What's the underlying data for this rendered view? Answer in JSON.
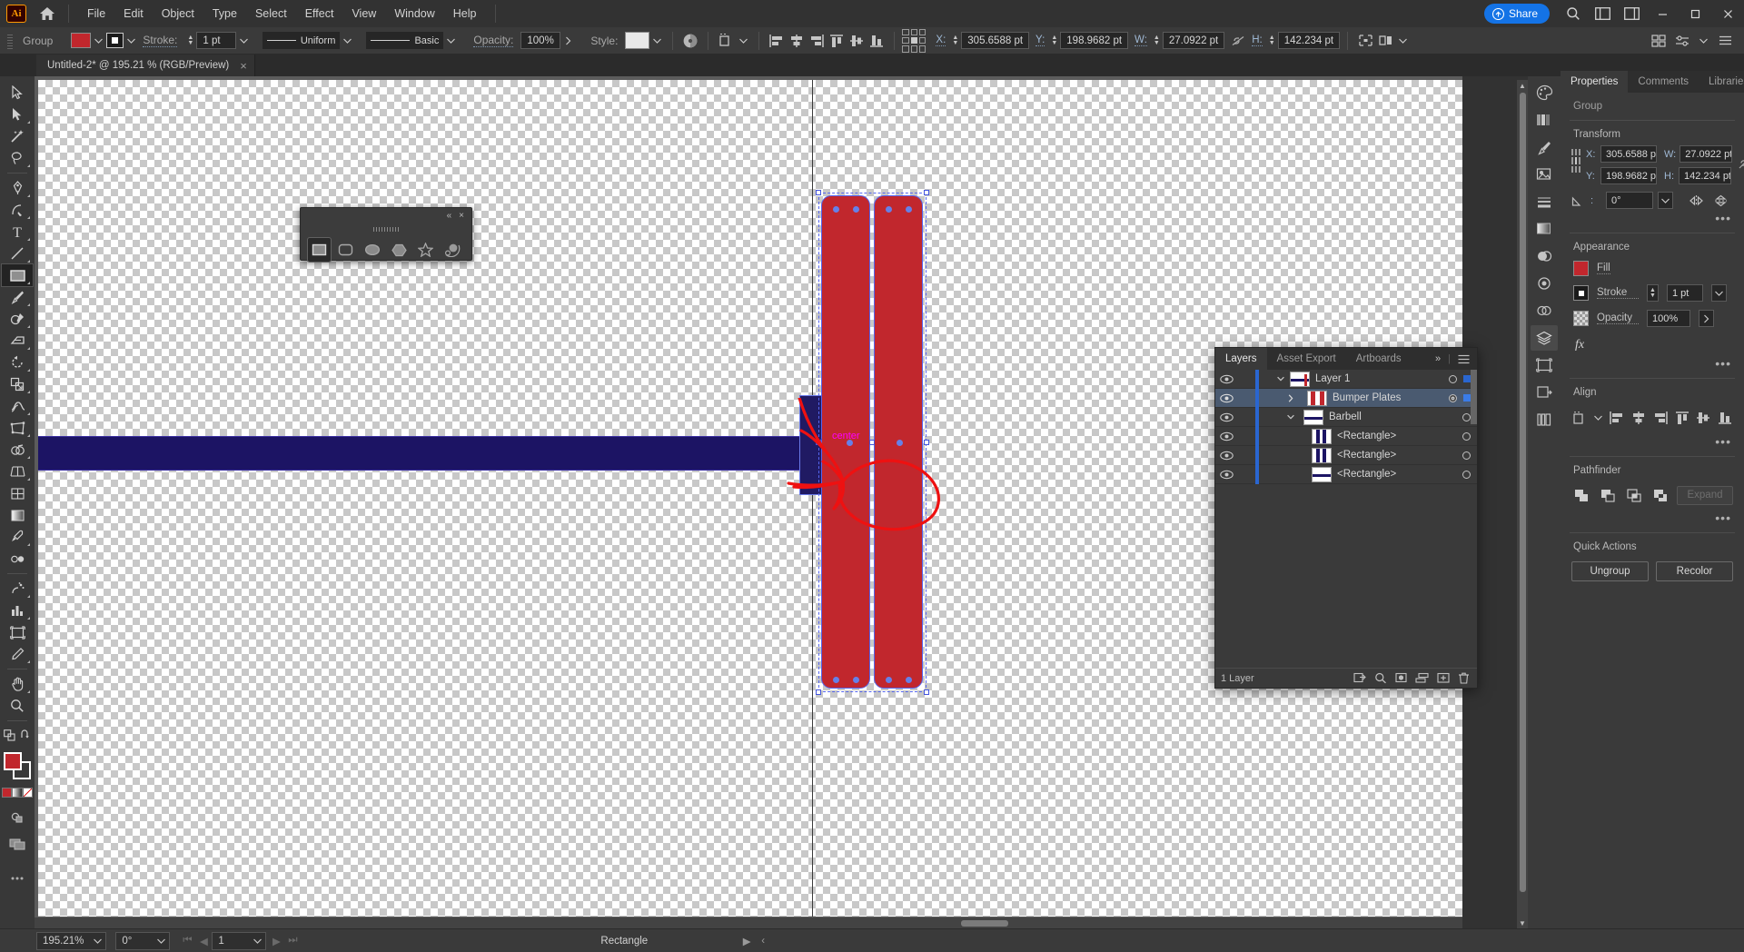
{
  "app": {
    "name": "Adobe Illustrator",
    "logo_text": "Ai"
  },
  "menubar": {
    "items": [
      "File",
      "Edit",
      "Object",
      "Type",
      "Select",
      "Effect",
      "View",
      "Window",
      "Help"
    ],
    "share_label": "Share",
    "icons": [
      "home-icon",
      "search-icon",
      "arrange-documents-icon",
      "workspace-switcher-icon"
    ],
    "window_controls": [
      "minimize",
      "maximize",
      "close"
    ]
  },
  "controlbar": {
    "selection_label": "Group",
    "fill_color": "#c1272d",
    "stroke_color": "#ffffff",
    "stroke_label": "Stroke:",
    "stroke_weight": "1 pt",
    "stroke_profile": "Uniform",
    "brush_definition": "Basic",
    "opacity_label": "Opacity:",
    "opacity_value": "100%",
    "style_label": "Style:",
    "transform": {
      "x_label": "X:",
      "x_value": "305.6588 pt",
      "y_label": "Y:",
      "y_value": "198.9682 pt",
      "w_label": "W:",
      "w_value": "27.0922 pt",
      "h_label": "H:",
      "h_value": "142.234 pt"
    }
  },
  "tabbar": {
    "documents": [
      {
        "title": "Untitled-2* @ 195.21 % (RGB/Preview)",
        "close": "×",
        "active": true
      }
    ]
  },
  "toolbar": {
    "tools": [
      "selection-tool",
      "direct-selection-tool",
      "magic-wand-tool",
      "lasso-tool",
      "pen-tool",
      "curvature-tool",
      "type-tool",
      "line-segment-tool",
      "rectangle-tool",
      "paintbrush-tool",
      "shaper-tool",
      "eraser-tool",
      "rotate-tool",
      "scale-tool",
      "width-tool",
      "free-transform-tool",
      "shape-builder-tool",
      "perspective-grid-tool",
      "mesh-tool",
      "gradient-tool",
      "eyedropper-tool",
      "blend-tool",
      "symbol-sprayer-tool",
      "column-graph-tool",
      "artboard-tool",
      "slice-tool",
      "hand-tool",
      "zoom-tool"
    ],
    "active_tool": "rectangle-tool",
    "fill_color": "#c1272d",
    "stroke_color": "#ffffff",
    "bottom_tools": [
      "swap-fill-stroke-icon",
      "default-fill-stroke-icon",
      "color-swatch-icon",
      "gradient-swatch-icon",
      "none-swatch-icon",
      "drawing-mode-icon",
      "screen-mode-icon",
      "edit-toolbar-icon"
    ]
  },
  "float_panel": {
    "name": "shape-tool-flyout",
    "collapse": "«",
    "close": "×",
    "shapes": [
      "rectangle-tool",
      "rounded-rectangle-tool",
      "ellipse-tool",
      "polygon-tool",
      "star-tool",
      "flare-tool"
    ],
    "selected": "rectangle-tool"
  },
  "canvas": {
    "artboard_label": "",
    "center_label": "center",
    "shape_fill": "#c1272d",
    "selection_color": "#5566ee",
    "bar_color": "#1c1464"
  },
  "properties": {
    "tabs": [
      "Properties",
      "Comments",
      "Libraries"
    ],
    "active_tab": "Properties",
    "object_type": "Group",
    "transform": {
      "title": "Transform",
      "x_label": "X:",
      "x_value": "305.6588 p",
      "y_label": "Y:",
      "y_value": "198.9682 p",
      "w_label": "W:",
      "w_value": "27.0922 pt",
      "h_label": "H:",
      "h_value": "142.234 pt",
      "angle_value": "0°",
      "link_icon": "constrain-proportions-unlinked-icon",
      "flip_icons": [
        "flip-horizontal-icon",
        "flip-vertical-icon"
      ]
    },
    "appearance": {
      "title": "Appearance",
      "fill_label": "Fill",
      "fill_color": "#c1272d",
      "stroke_label": "Stroke",
      "stroke_value": "1 pt",
      "opacity_label": "Opacity",
      "opacity_value": "100%",
      "fx_label": "fx"
    },
    "align": {
      "title": "Align",
      "buttons": [
        "align-to-selection-icon",
        "align-left-icon",
        "align-horizontal-center-icon",
        "align-right-icon",
        "align-top-icon",
        "align-vertical-center-icon",
        "align-bottom-icon"
      ]
    },
    "pathfinder": {
      "title": "Pathfinder",
      "buttons": [
        "unite-icon",
        "minus-front-icon",
        "intersect-icon",
        "exclude-icon"
      ],
      "expand_label": "Expand"
    },
    "quick_actions": {
      "title": "Quick Actions",
      "buttons": [
        "Ungroup",
        "Recolor"
      ]
    },
    "more_label": "•••"
  },
  "rail": {
    "icons": [
      "color-panel-icon",
      "color-guide-icon",
      "properties-panel-icon",
      "brushes-panel-icon",
      "symbols-panel-icon",
      "stroke-panel-icon",
      "gradient-panel-icon",
      "transparency-panel-icon",
      "appearance-panel-icon",
      "graphic-styles-icon",
      "layers-panel-icon",
      "artboards-panel-icon",
      "asset-export-icon",
      "libraries-panel-icon"
    ]
  },
  "layers_panel": {
    "tabs": [
      "Layers",
      "Asset Export",
      "Artboards"
    ],
    "active_tab": "Layers",
    "collapse_icon": "»",
    "menu_icon": "panel-menu-icon",
    "rows": [
      {
        "name": "Layer 1",
        "indent": 0,
        "expanded": true,
        "arrow": "⌄",
        "selected": false,
        "has_target_square": true,
        "double_target": false,
        "color": "#2a66d0"
      },
      {
        "name": "Bumper Plates",
        "indent": 1,
        "expanded": false,
        "arrow": "›",
        "selected": true,
        "has_target_square": true,
        "double_target": true,
        "color": "#2a66d0"
      },
      {
        "name": "Barbell",
        "indent": 1,
        "expanded": true,
        "arrow": "⌄",
        "selected": false,
        "has_target_square": false,
        "double_target": false,
        "color": "#2a66d0"
      },
      {
        "name": "<Rectangle>",
        "indent": 2,
        "expanded": null,
        "arrow": "",
        "selected": false,
        "has_target_square": false,
        "double_target": false,
        "color": "#2a66d0"
      },
      {
        "name": "<Rectangle>",
        "indent": 2,
        "expanded": null,
        "arrow": "",
        "selected": false,
        "has_target_square": false,
        "double_target": false,
        "color": "#2a66d0"
      },
      {
        "name": "<Rectangle>",
        "indent": 2,
        "expanded": null,
        "arrow": "",
        "selected": false,
        "has_target_square": false,
        "double_target": false,
        "color": "#2a66d0"
      }
    ],
    "footer_text": "1 Layer",
    "footer_icons": [
      "locate-object-icon",
      "find-icon",
      "make-clipping-mask-icon",
      "create-sublayer-icon",
      "create-layer-icon",
      "delete-selection-icon"
    ]
  },
  "statusbar": {
    "zoom_value": "195.21%",
    "rotate_value": "0°",
    "artboard_number": "1",
    "nav_first": "⏮",
    "nav_prev": "◀",
    "nav_next": "▶",
    "nav_last": "⏭",
    "tool_name": "Rectangle",
    "play_icon": "▶",
    "chevron_icon": "‹"
  }
}
